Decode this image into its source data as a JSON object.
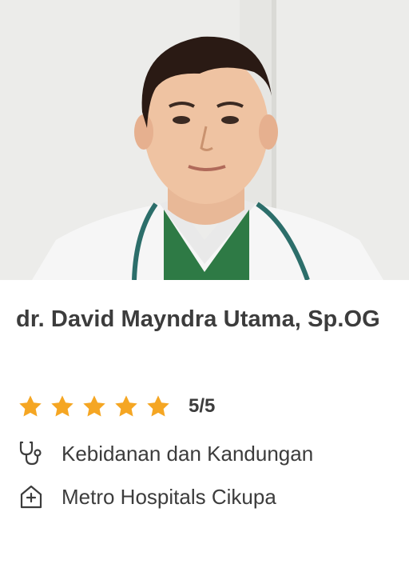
{
  "doctor": {
    "name": "dr. David Mayndra Utama, Sp.OG",
    "rating": {
      "stars": 5,
      "score_text": "5/5",
      "star_color": "#f5a623"
    },
    "specialty": "Kebidanan dan Kandungan",
    "hospital": "Metro Hospitals Cikupa",
    "icons": {
      "specialty": "stethoscope-icon",
      "hospital": "hospital-icon"
    }
  }
}
